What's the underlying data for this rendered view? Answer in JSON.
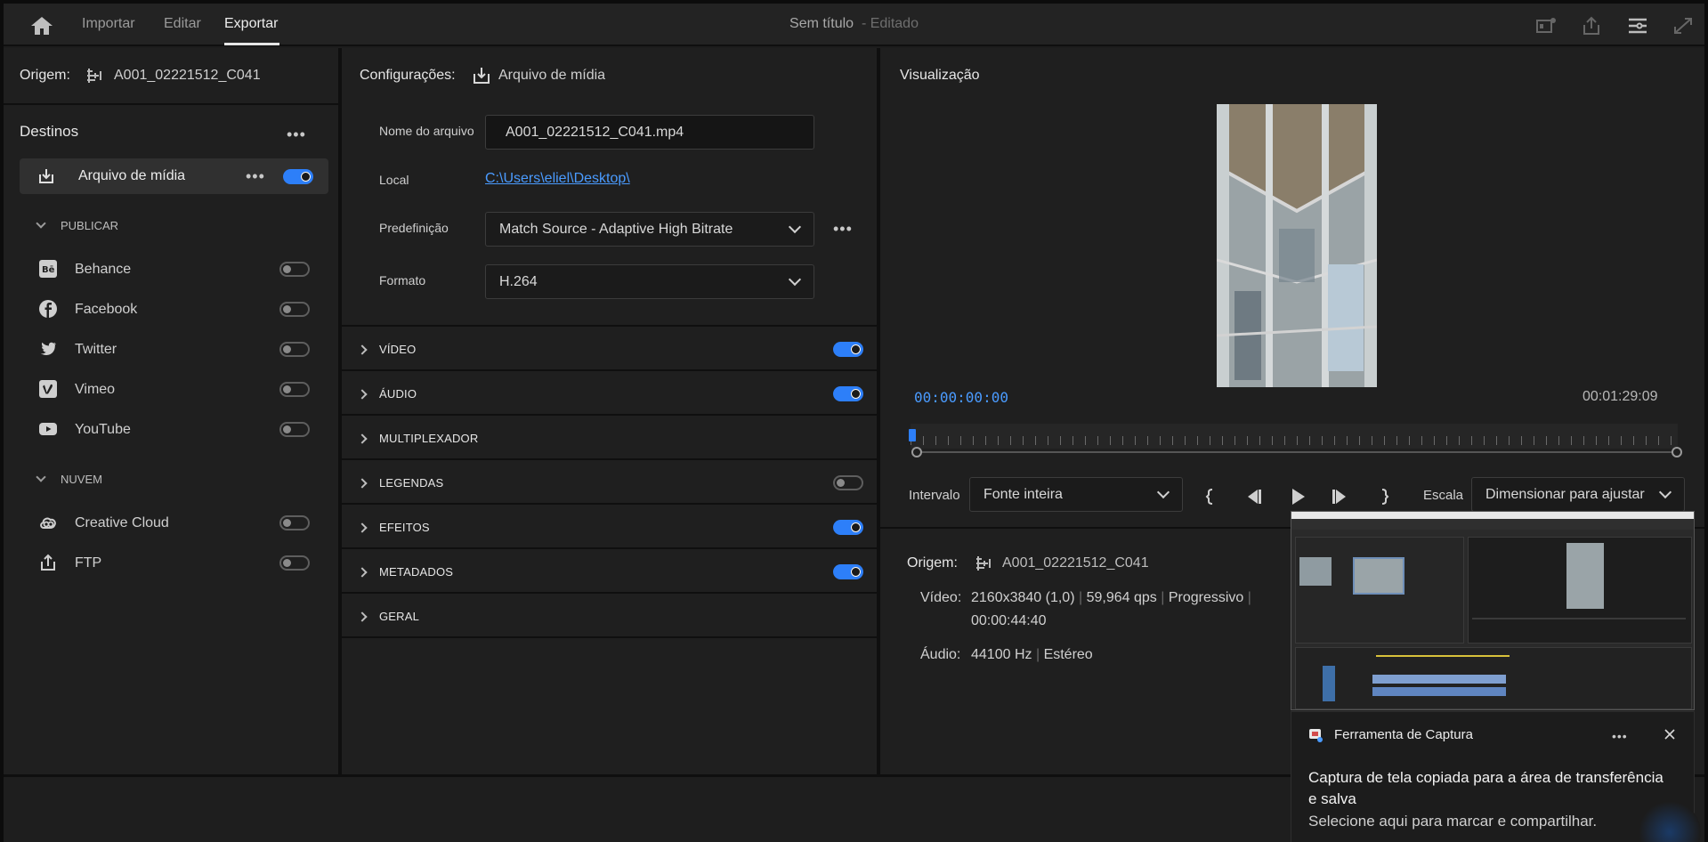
{
  "topbar": {
    "tabs": [
      "Importar",
      "Editar",
      "Exportar"
    ],
    "doc_title": "Sem título",
    "doc_status": "- Editado"
  },
  "source_panel": {
    "origin_label": "Origem:",
    "origin_name": "A001_02221512_C041",
    "destinations_title": "Destinos",
    "media_file": "Arquivo de mídia",
    "publish_header": "PUBLICAR",
    "publish_items": [
      "Behance",
      "Facebook",
      "Twitter",
      "Vimeo",
      "YouTube"
    ],
    "cloud_header": "NUVEM",
    "cloud_items": [
      "Creative Cloud",
      "FTP"
    ]
  },
  "settings_panel": {
    "title": "Configurações:",
    "title_target": "Arquivo de mídia",
    "filename_label": "Nome do arquivo",
    "filename_value": "A001_02221512_C041.mp4",
    "location_label": "Local",
    "location_value": "C:\\Users\\eliel\\Desktop\\",
    "preset_label": "Predefinição",
    "preset_value": "Match Source - Adaptive High Bitrate",
    "format_label": "Formato",
    "format_value": "H.264",
    "sections": [
      {
        "label": "VÍDEO",
        "toggle": "on"
      },
      {
        "label": "ÁUDIO",
        "toggle": "on"
      },
      {
        "label": "MULTIPLEXADOR",
        "toggle": "none"
      },
      {
        "label": "LEGENDAS",
        "toggle": "off"
      },
      {
        "label": "EFEITOS",
        "toggle": "on"
      },
      {
        "label": "METADADOS",
        "toggle": "on"
      },
      {
        "label": "GERAL",
        "toggle": "none"
      }
    ]
  },
  "preview_panel": {
    "title": "Visualização",
    "timecode_start": "00:00:00:00",
    "timecode_end": "00:01:29:09",
    "range_label": "Intervalo",
    "range_value": "Fonte inteira",
    "scale_label": "Escala",
    "scale_value": "Dimensionar para ajustar",
    "info_origin_label": "Origem:",
    "info_origin_name": "A001_02221512_C041",
    "video_label": "Vídeo:",
    "video_res": "2160x3840 (1,0)",
    "video_fps": "59,964 qps",
    "video_scan": "Progressivo",
    "video_duration": "00:00:44:40",
    "audio_label": "Áudio:",
    "audio_rate": "44100 Hz",
    "audio_channels": "Estéreo"
  },
  "toast": {
    "app_name": "Ferramenta de Captura",
    "message_line1": "Captura de tela copiada para a área de transferência",
    "message_line2": "e salva",
    "message_sub": "Selecione aqui para marcar e compartilhar."
  },
  "colors": {
    "accent": "#2d7ff9",
    "timecode": "#4a9bff",
    "background": "#1f1f1f"
  }
}
